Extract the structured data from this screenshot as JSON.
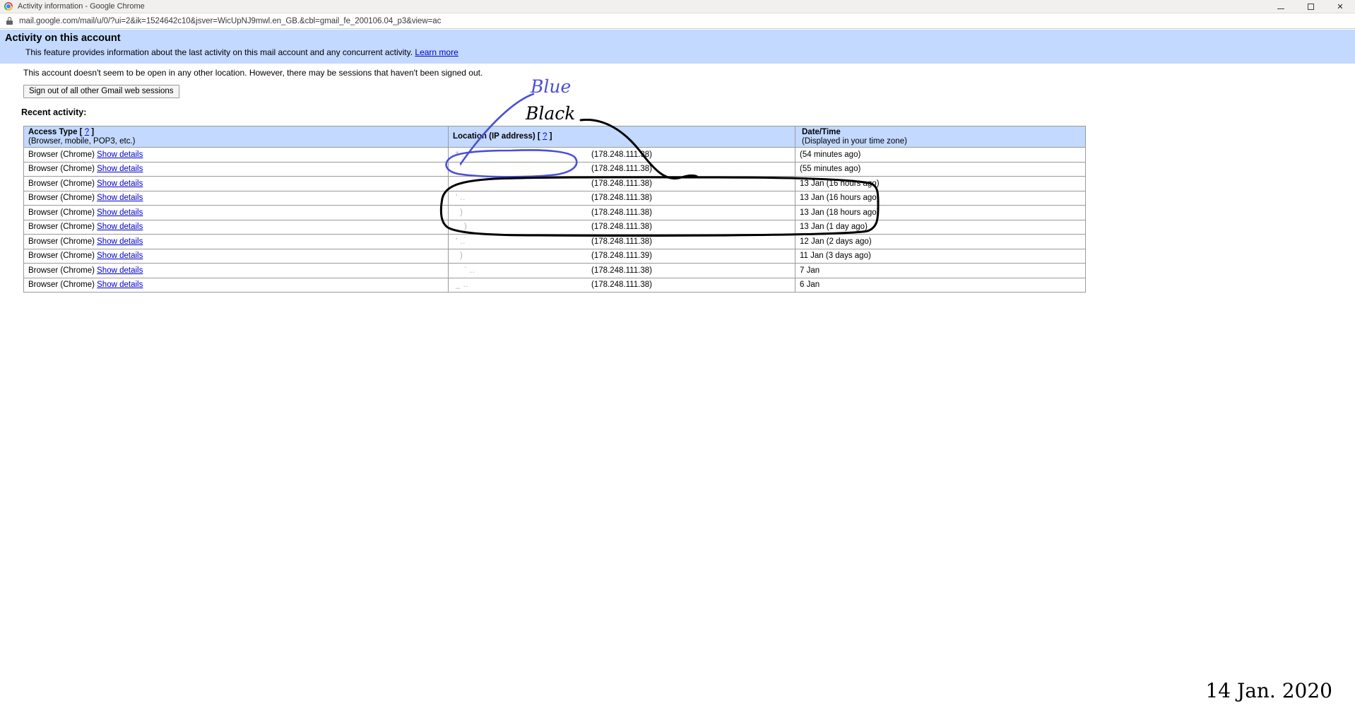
{
  "window": {
    "title": "Activity information - Google Chrome",
    "minimize_label": "Minimize",
    "maximize_label": "Maximize",
    "close_label": "✕"
  },
  "address_bar": {
    "url": "mail.google.com/mail/u/0/?ui=2&ik=1524642c10&jsver=WicUpNJ9mwl.en_GB.&cbl=gmail_fe_200106.04_p3&view=ac",
    "security_icon": "lock-icon"
  },
  "banner": {
    "title": "Activity on this account",
    "description": "This feature provides information about the last activity on this mail account and any concurrent activity.",
    "learn_more": "Learn more",
    "background_color": "#c3d9ff"
  },
  "notice": "This account doesn't seem to be open in any other location. However, there may be sessions that haven't been signed out.",
  "signout_button": "Sign out of all other Gmail web sessions",
  "recent_activity_label": "Recent activity:",
  "table": {
    "headers": [
      {
        "main": "Access Type",
        "help": "?",
        "sub": "(Browser, mobile, POP3, etc.)"
      },
      {
        "main": "Location (IP address)",
        "help": "?",
        "sub": ""
      },
      {
        "main": "Date/Time",
        "help": "",
        "sub": "(Displayed in your time zone)"
      }
    ],
    "rows": [
      {
        "access": "Browser (Chrome)",
        "details": "Show details",
        "location_redacted": "* ..",
        "ip": "(178.248.111.38)",
        "datetime": "(54 minutes ago)"
      },
      {
        "access": "Browser (Chrome)",
        "details": "Show details",
        "location_redacted": "'",
        "ip": "(178.248.111.38)",
        "datetime": "(55 minutes ago)"
      },
      {
        "access": "Browser (Chrome)",
        "details": "Show details",
        "location_redacted": "",
        "ip": "(178.248.111.38)",
        "datetime": "13 Jan (16 hours ago)"
      },
      {
        "access": "Browser (Chrome)",
        "details": "Show details",
        "location_redacted": "' ..",
        "ip": "(178.248.111.38)",
        "datetime": "13 Jan (16 hours ago)"
      },
      {
        "access": "Browser (Chrome)",
        "details": "Show details",
        "location_redacted": ") ",
        "ip": "(178.248.111.38)",
        "datetime": "13 Jan (18 hours ago)"
      },
      {
        "access": "Browser (Chrome)",
        "details": "Show details",
        "location_redacted": ") ",
        "ip": "(178.248.111.38)",
        "datetime": "13 Jan (1 day ago)"
      },
      {
        "access": "Browser (Chrome)",
        "details": "Show details",
        "location_redacted": "' ..",
        "ip": "(178.248.111.38)",
        "datetime": "12 Jan (2 days ago)"
      },
      {
        "access": "Browser (Chrome)",
        "details": "Show details",
        "location_redacted": ") ",
        "ip": "(178.248.111.39)",
        "datetime": "11 Jan (3 days ago)"
      },
      {
        "access": "Browser (Chrome)",
        "details": "Show details",
        "location_redacted": "` ..",
        "ip": "(178.248.111.38)",
        "datetime": "7 Jan"
      },
      {
        "access": "Browser (Chrome)",
        "details": "Show details",
        "location_redacted": "_ ..",
        "ip": "(178.248.111.38)",
        "datetime": "6 Jan"
      }
    ]
  },
  "annotations": {
    "blue_label": "Blue",
    "black_label": "Black",
    "blue_color": "#4a4fd8",
    "black_color": "#000000",
    "date_stamp": "14 Jan. 2020"
  }
}
